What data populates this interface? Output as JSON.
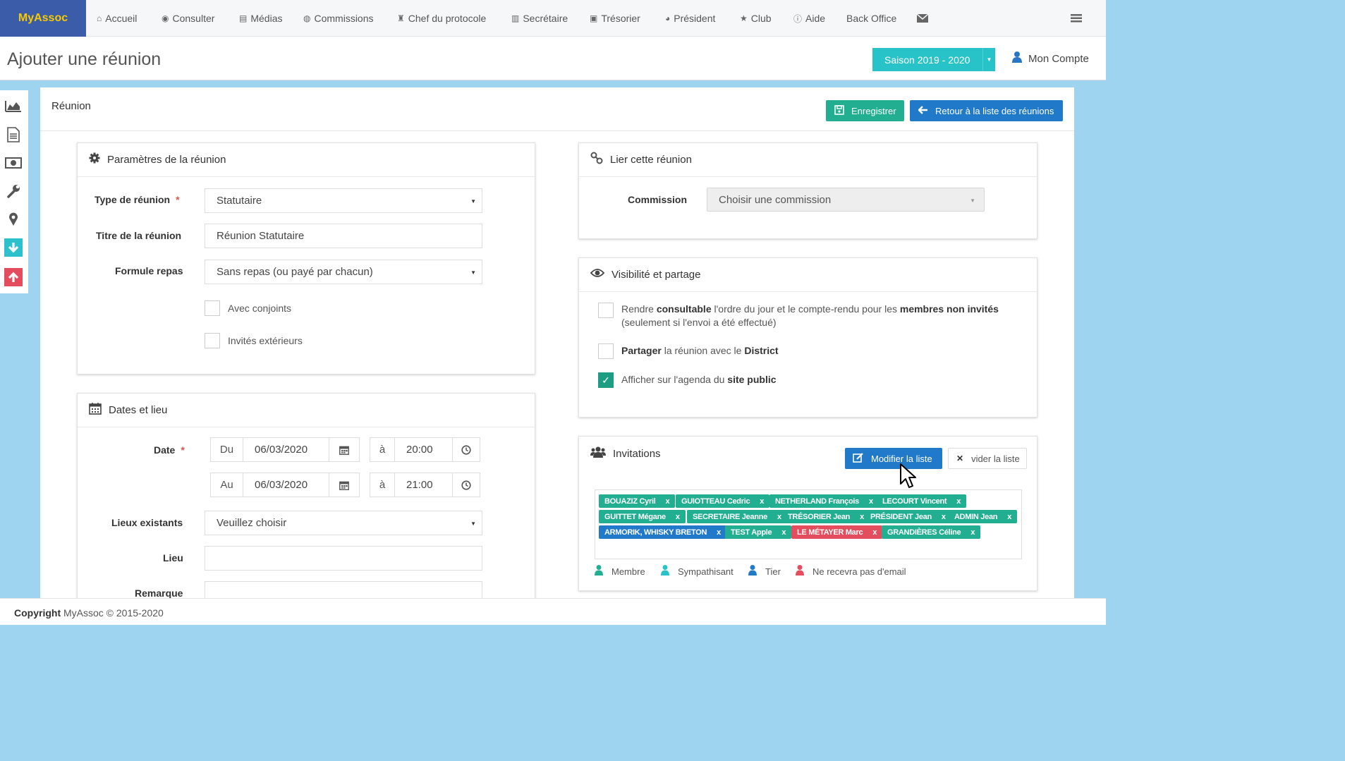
{
  "brand": "MyAssoc",
  "nav": [
    {
      "label": "Accueil",
      "icon": "home-icon",
      "glyph": "⌂"
    },
    {
      "label": "Consulter",
      "icon": "eye-icon",
      "glyph": "◉"
    },
    {
      "label": "Médias",
      "icon": "file-icon",
      "glyph": "▤"
    },
    {
      "label": "Commissions",
      "icon": "users-circle-icon",
      "glyph": "◍"
    },
    {
      "label": "Chef du protocole",
      "icon": "trophy-icon",
      "glyph": "♜"
    },
    {
      "label": "Secrétaire",
      "icon": "book-icon",
      "glyph": "▥"
    },
    {
      "label": "Trésorier",
      "icon": "money-icon",
      "glyph": "▣"
    },
    {
      "label": "Président",
      "icon": "globe-icon",
      "glyph": "◕"
    },
    {
      "label": "Club",
      "icon": "star-icon",
      "glyph": "★"
    },
    {
      "label": "Aide",
      "icon": "info-icon",
      "glyph": "ⓘ"
    },
    {
      "label": "Back Office",
      "icon": "",
      "glyph": ""
    }
  ],
  "header": {
    "title": "Ajouter une réunion",
    "season": "Saison 2019 - 2020",
    "account": "Mon Compte"
  },
  "main": {
    "title": "Réunion",
    "save_label": "Enregistrer",
    "back_label": "Retour à la liste des réunions"
  },
  "params": {
    "title": "Paramètres de la réunion",
    "type_label": "Type de réunion",
    "type_value": "Statutaire",
    "titre_label": "Titre de la réunion",
    "titre_value": "Réunion Statutaire",
    "formule_label": "Formule repas",
    "formule_value": "Sans repas (ou payé par chacun)",
    "conjoints_label": "Avec conjoints",
    "invites_label": "Invités extérieurs"
  },
  "dates": {
    "title": "Dates et lieu",
    "date_label": "Date",
    "du_label": "Du",
    "du_date": "06/03/2020",
    "a_label": "à",
    "du_time": "20:00",
    "au_label": "Au",
    "au_date": "06/03/2020",
    "au_time": "21:00",
    "lieux_label": "Lieux existants",
    "lieux_value": "Veuillez choisir",
    "lieu_label": "Lieu",
    "lieu_value": "",
    "remarque_label": "Remarque"
  },
  "lier": {
    "title": "Lier cette réunion",
    "commission_label": "Commission",
    "commission_placeholder": "Choisir une commission"
  },
  "visibilite": {
    "title": "Visibilité et partage",
    "opt1_a": "Rendre ",
    "opt1_b": "consultable",
    "opt1_c": " l'ordre du jour et le compte-rendu pour les ",
    "opt1_d": "membres non invités",
    "opt1_e": "(seulement si l'envoi a été effectué)",
    "opt2_a": "Partager",
    "opt2_b": " la réunion avec le ",
    "opt2_c": "District",
    "opt3_a": "Afficher sur l'agenda du ",
    "opt3_b": "site public",
    "opt3_checked": true
  },
  "invitations": {
    "title": "Invitations",
    "modify_label": "Modifier la liste",
    "clear_label": "vider la liste",
    "tags": [
      {
        "name": "BOUAZIZ Cyril",
        "kind": "green"
      },
      {
        "name": "GUIOTTEAU Cedric",
        "kind": "green"
      },
      {
        "name": "NETHERLAND François",
        "kind": "green"
      },
      {
        "name": "LECOURT Vincent",
        "kind": "green"
      },
      {
        "name": "GUITTET Mégane",
        "kind": "green"
      },
      {
        "name": "SECRETAIRE Jeanne",
        "kind": "green"
      },
      {
        "name": "TRÉSORIER Jean",
        "kind": "green"
      },
      {
        "name": "PRÉSIDENT Jean",
        "kind": "green"
      },
      {
        "name": "ADMIN Jean",
        "kind": "green"
      },
      {
        "name": "ARMORIK, WHISKY BRETON",
        "kind": "blue"
      },
      {
        "name": "TEST Apple",
        "kind": "green"
      },
      {
        "name": "LE MÉTAYER Marc",
        "kind": "red"
      },
      {
        "name": "GRANDIÈRES Céline",
        "kind": "green"
      }
    ],
    "remove_glyph": "x",
    "legend": [
      {
        "label": "Membre",
        "color": "#21ae91"
      },
      {
        "label": "Sympathisant",
        "color": "#28c3c9"
      },
      {
        "label": "Tier",
        "color": "#2179c9"
      },
      {
        "label": "Ne recevra pas d'email",
        "color": "#e44d5e"
      }
    ]
  },
  "footer": {
    "bold": "Copyright",
    "text": " MyAssoc © 2015-2020"
  }
}
